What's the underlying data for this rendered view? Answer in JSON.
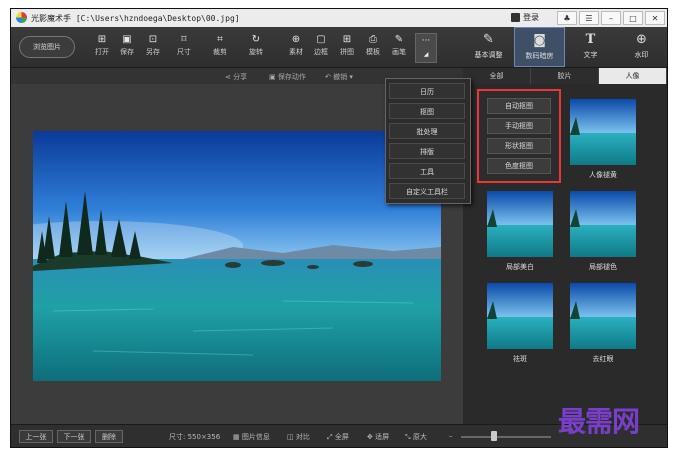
{
  "window": {
    "title": "光影魔术手 [C:\\Users\\hzndoega\\Desktop\\00.jpg]",
    "login_label": "登录",
    "controls": [
      "♣",
      "☰",
      "–",
      "□",
      "✕"
    ]
  },
  "toolbar": {
    "browse_label": "浏览图片",
    "tools": [
      {
        "label": "打开",
        "icon": "open-icon",
        "glyph": "⊞"
      },
      {
        "label": "保存",
        "icon": "save-icon",
        "glyph": "▣"
      },
      {
        "label": "另存",
        "icon": "save-as-icon",
        "glyph": "⊡"
      },
      {
        "label": "尺寸",
        "icon": "resize-icon",
        "glyph": "⌑"
      },
      {
        "label": "裁剪",
        "icon": "crop-icon",
        "glyph": "⌗"
      },
      {
        "label": "旋转",
        "icon": "rotate-icon",
        "glyph": "↻"
      },
      {
        "label": "素材",
        "icon": "material-icon",
        "glyph": "⊕"
      },
      {
        "label": "边框",
        "icon": "border-icon",
        "glyph": "▢"
      },
      {
        "label": "拼图",
        "icon": "puzzle-icon",
        "glyph": "⊞"
      },
      {
        "label": "模板",
        "icon": "template-icon",
        "glyph": "⎙"
      },
      {
        "label": "画笔",
        "icon": "brush-icon",
        "glyph": "✎"
      }
    ],
    "more_glyph": "···",
    "right_tabs": [
      {
        "label": "基本调整",
        "icon": "adjust-icon",
        "glyph": "✎"
      },
      {
        "label": "数码暗房",
        "icon": "darkroom-icon",
        "glyph": "◙"
      },
      {
        "label": "文字",
        "icon": "text-icon",
        "glyph": "T"
      },
      {
        "label": "水印",
        "icon": "watermark-icon",
        "glyph": "⊕"
      }
    ]
  },
  "subbar": {
    "share": "分享",
    "save_action": "保存动作",
    "undo": "撤销"
  },
  "panel_tabs": [
    "全部",
    "胶片",
    "人像"
  ],
  "dropdown_menu": [
    "日历",
    "抠图",
    "批处理",
    "排版",
    "工具",
    "自定义工具栏"
  ],
  "submenu": [
    "自动抠图",
    "手动抠图",
    "形状抠图",
    "色度抠图"
  ],
  "thumbnails": [
    {
      "caption": "人像褪黄"
    },
    {
      "caption": "局部美白"
    },
    {
      "caption": "局部褪色"
    },
    {
      "caption": "祛斑"
    },
    {
      "caption": "去红眼"
    }
  ],
  "bottombar": {
    "prev": "上一张",
    "next": "下一张",
    "delete": "删除",
    "size_info": "尺寸: 550×356",
    "image_info": "图片信息",
    "compare": "对比",
    "fullscreen": "全屏",
    "fit": "适屏",
    "enlarge": "原大"
  },
  "watermark_text": "最需网",
  "colors": {
    "highlight": "#e53935",
    "active_tab": "#3f4f66"
  }
}
